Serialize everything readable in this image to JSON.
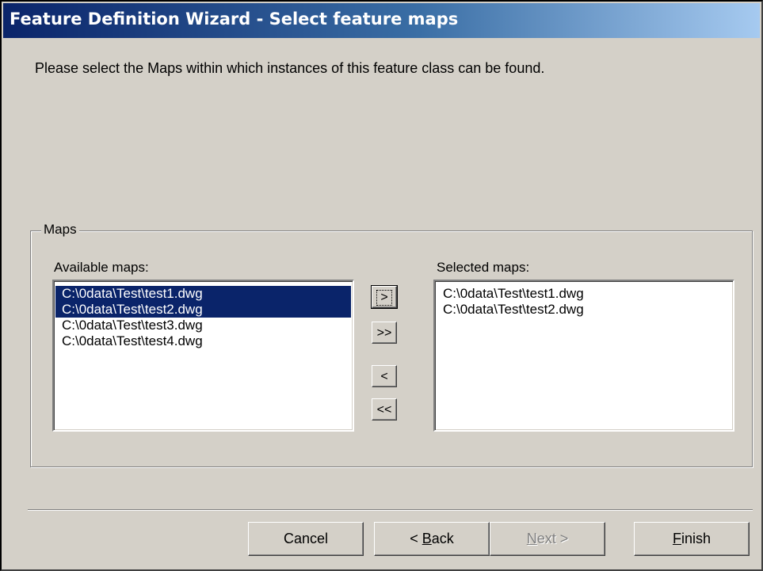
{
  "window": {
    "title": "Feature Definition Wizard - Select feature maps"
  },
  "intro_text": "Please select the Maps within which instances of this feature class can be found.",
  "maps_group": {
    "legend": "Maps",
    "available_label": "Available maps:",
    "selected_label": "Selected maps:",
    "available_items": [
      {
        "label": "C:\\0data\\Test\\test1.dwg",
        "selected": true
      },
      {
        "label": "C:\\0data\\Test\\test2.dwg",
        "selected": true
      },
      {
        "label": "C:\\0data\\Test\\test3.dwg",
        "selected": false
      },
      {
        "label": "C:\\0data\\Test\\test4.dwg",
        "selected": false
      }
    ],
    "selected_items": [
      {
        "label": "C:\\0data\\Test\\test1.dwg"
      },
      {
        "label": "C:\\0data\\Test\\test2.dwg"
      }
    ],
    "move_buttons": {
      "add": ">",
      "add_all": ">>",
      "remove": "<",
      "remove_all": "<<"
    }
  },
  "footer": {
    "cancel": "Cancel",
    "back_prefix": "< ",
    "back_accel": "B",
    "back_rest": "ack",
    "next_accel": "N",
    "next_rest": "ext >",
    "finish_accel": "F",
    "finish_rest": "inish"
  },
  "colors": {
    "dialog_face": "#d4d0c8",
    "selection": "#0a246a",
    "title_gradient_start": "#0a246a",
    "title_gradient_end": "#a6caf0"
  }
}
